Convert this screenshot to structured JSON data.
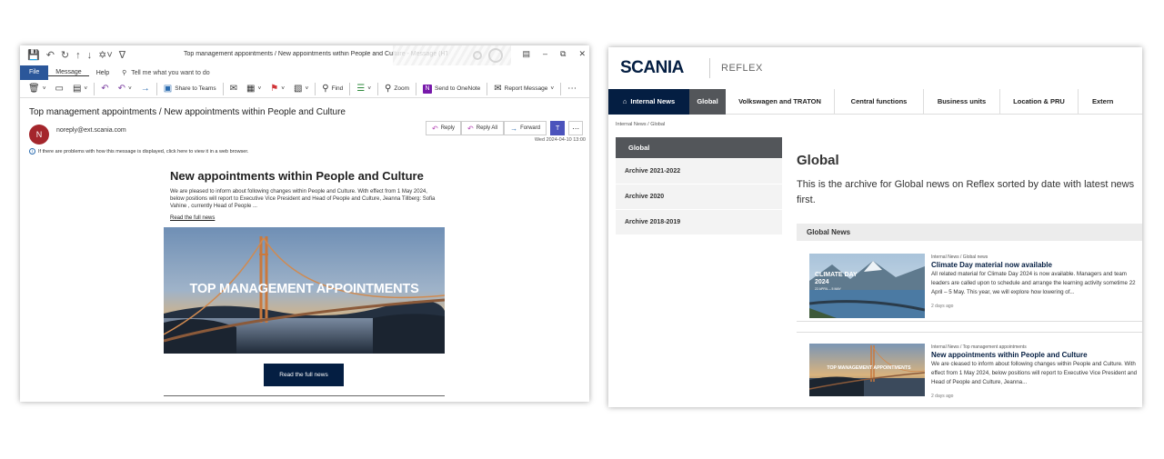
{
  "outlook": {
    "window_title": "Top management appointments / New appointments within People and Culture  -  Message (HTML)",
    "tabs": {
      "file": "File",
      "message": "Message",
      "help": "Help",
      "tell_me": "Tell me what you want to do"
    },
    "ribbon": {
      "share_to_teams": "Share to Teams",
      "find": "Find",
      "zoom": "Zoom",
      "send_to_onenote": "Send to OneNote",
      "report_message": "Report Message"
    },
    "subject": "Top management appointments / New appointments within People and Culture",
    "sender": {
      "initial": "N",
      "address": "noreply@ext.scania.com"
    },
    "actions": {
      "reply": "Reply",
      "reply_all": "Reply All",
      "forward": "Forward"
    },
    "date": "Wed 2024-04-10 13:00",
    "info_bar": "If there are problems with how this message is displayed, click here to view it in a web browser.",
    "body": {
      "headline": "New appointments within People and Culture",
      "intro": "We are pleased to inform about following changes within People and Culture. With effect from 1 May 2024, below positions will report to Executive Vice President and Head of People and Culture, Jeanna Tillberg: Sofia Vahine , currently Head of People ...",
      "read_link": "Read the full news",
      "hero_text": "TOP MANAGEMENT APPOINTMENTS",
      "cta": "Read the full news"
    }
  },
  "reflex": {
    "logo": "SCANIA",
    "brand": "REFLEX",
    "nav": {
      "internal_news": "Internal News",
      "global": "Global",
      "vw_traton": "Volkswagen and TRATON",
      "central_functions": "Central functions",
      "business_units": "Business units",
      "location_pru": "Location & PRU",
      "external": "Extern"
    },
    "breadcrumb": "Internal News  /  Global",
    "sidebar": {
      "heading": "Global",
      "items": [
        {
          "label": "Archive 2021-2022"
        },
        {
          "label": "Archive 2020"
        },
        {
          "label": "Archive 2018-2019"
        }
      ]
    },
    "page_title": "Global",
    "description": "This is the archive for Global news on Reflex sorted by date with latest news first.",
    "list_heading": "Global News",
    "articles": [
      {
        "meta": "Internal News  /  Global news",
        "title": "Climate Day material now available",
        "summary": "All related material for Climate Day 2024 is now available. Managers and team leaders are called upon to schedule and arrange the learning activity sometime 22 April – 5 May. This year, we will explore how lowering of...",
        "age": "2 days ago",
        "thumb_title": "CLIMATE DAY 2024",
        "thumb_sub": "22 APRIL – 5 MAY"
      },
      {
        "meta": "Internal News  /  Top management appointments",
        "title": "New appointments within People and Culture",
        "summary": "We are cleased to inform about following changes within People and Culture. With effect from 1 May 2024, below positions will report to Executive Vice President and Head of People and Culture, Jeanna...",
        "age": "2 days ago",
        "thumb_title": "TOP MANAGEMENT APPOINTMENTS"
      }
    ]
  }
}
